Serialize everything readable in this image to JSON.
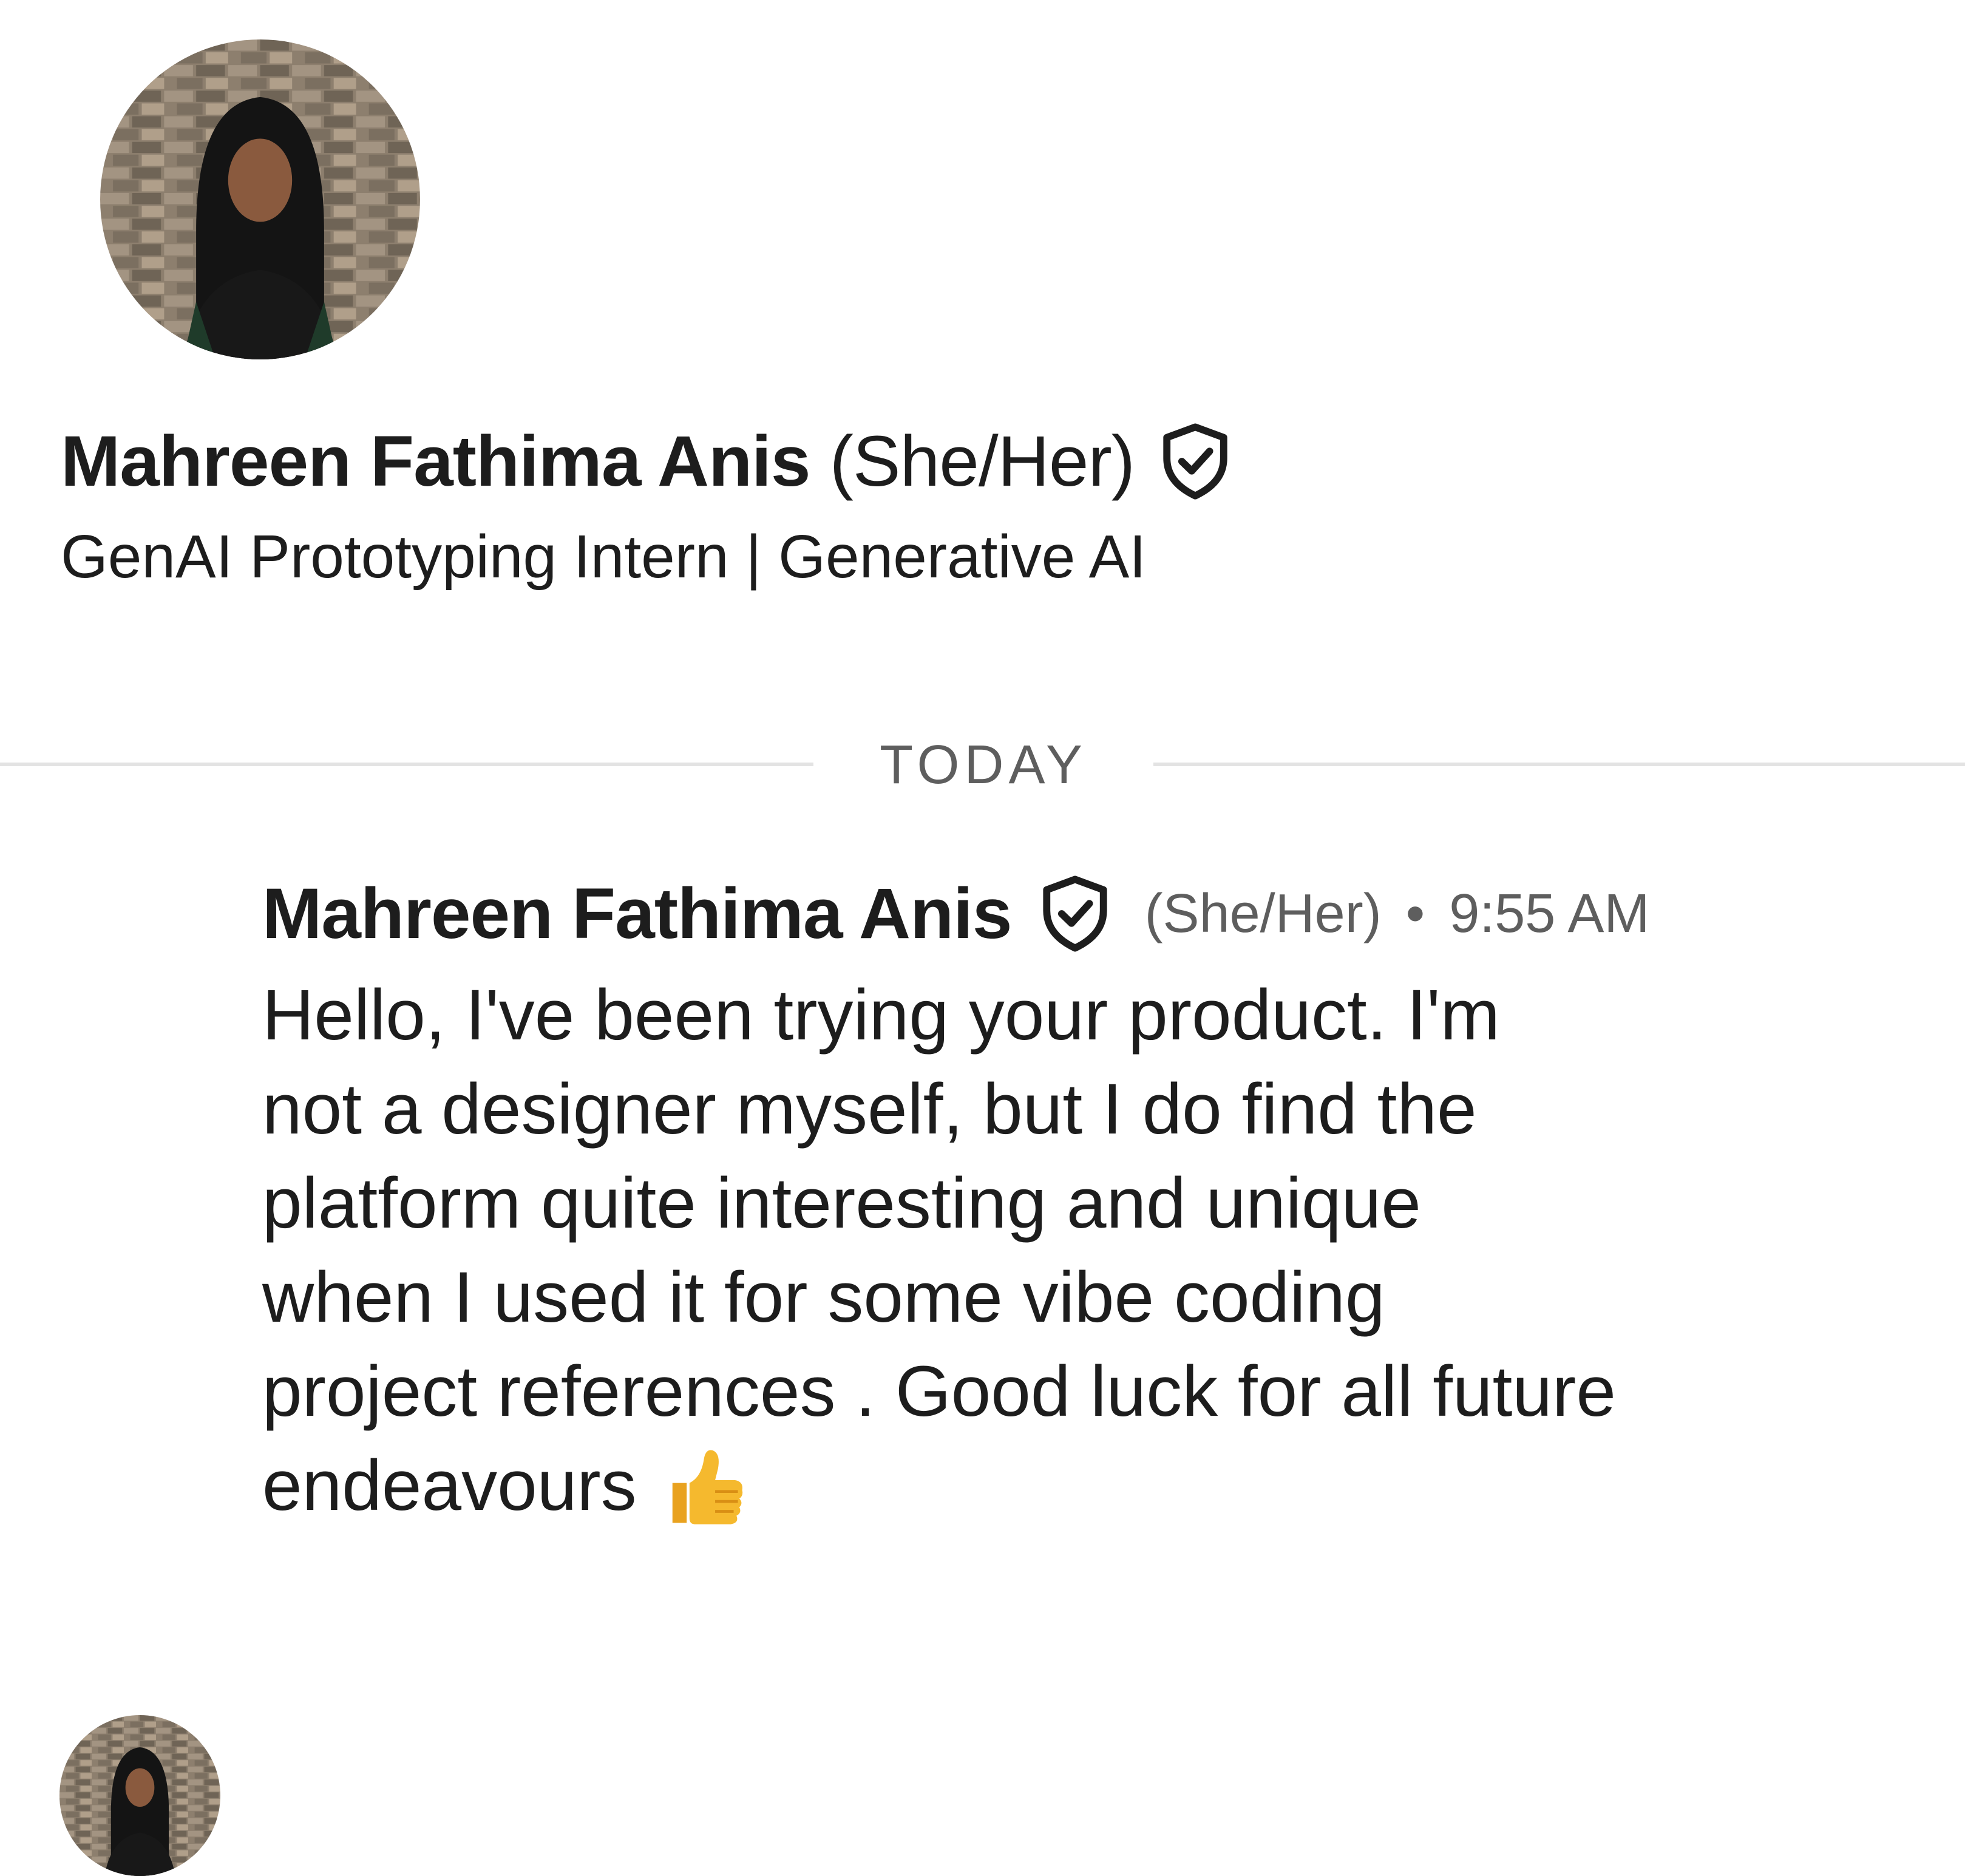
{
  "profile": {
    "name": "Mahreen Fathima Anis",
    "pronouns": "(She/Her)",
    "headline": "GenAI Prototyping Intern | Generative AI",
    "avatar_icon": "avatar-photo",
    "verified_icon": "verified-shield-icon"
  },
  "divider": {
    "label": "TODAY"
  },
  "message": {
    "sender": "Mahreen Fathima Anis",
    "pronouns": "(She/Her)",
    "separator": "•",
    "time": "9:55 AM",
    "body_lines": [
      "Hello, I've been trying your product. I'm",
      "not a designer myself,  but I do find the",
      "platform quite interesting and unique",
      "when I used it for some vibe coding",
      "project references . Good luck for all future",
      "endeavours"
    ],
    "emoji": "thumbs-up-icon"
  },
  "colors": {
    "text": "#1d1d1d",
    "muted": "#5e5e5e",
    "divider": "#e3e3e3",
    "emoji": "#f5b92e"
  }
}
